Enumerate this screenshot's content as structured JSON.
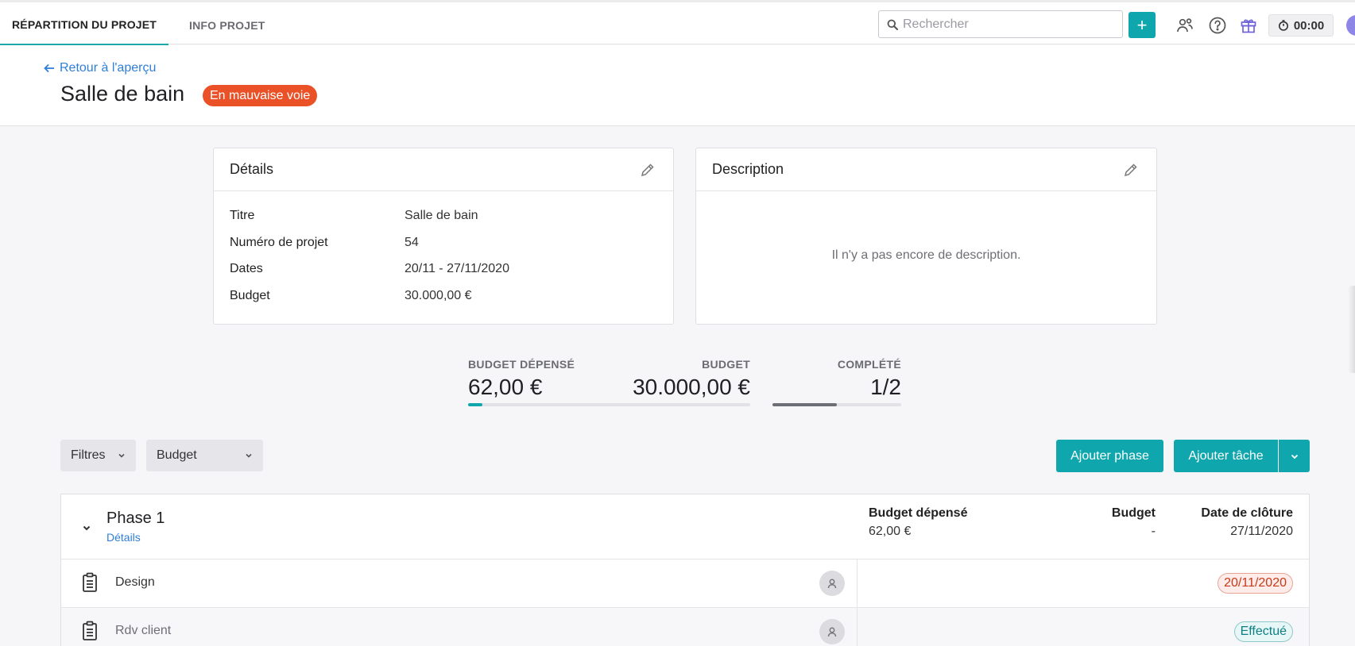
{
  "nav": {
    "tabs": [
      {
        "label": "RÉPARTITION DU PROJET",
        "active": true
      },
      {
        "label": "INFO PROJET",
        "active": false
      }
    ],
    "search_placeholder": "Rechercher",
    "add_label": "+",
    "timer": "00:00",
    "icons": [
      "search-icon",
      "team-icon",
      "help-icon",
      "gift-icon",
      "timer-icon",
      "avatar"
    ]
  },
  "header": {
    "back_link": "Retour à l'aperçu",
    "title": "Salle de bain",
    "status": "En mauvaise voie",
    "status_color": "#ea5126"
  },
  "details": {
    "heading": "Détails",
    "rows": [
      {
        "label": "Titre",
        "value": "Salle de bain"
      },
      {
        "label": "Numéro de projet",
        "value": "54"
      },
      {
        "label": "Dates",
        "value": "20/11 - 27/11/2020"
      },
      {
        "label": "Budget",
        "value": "30.000,00 €"
      }
    ]
  },
  "description": {
    "heading": "Description",
    "empty_text": "Il n'y a pas encore de description."
  },
  "stats": {
    "spent_label": "BUDGET DÉPENSÉ",
    "spent_value": "62,00 €",
    "budget_label": "BUDGET",
    "budget_value": "30.000,00 €",
    "budget_progress": 0.0021,
    "completed_label": "COMPLÉTÉ",
    "completed_value": "1/2",
    "completed_progress": 0.5,
    "accent": "#0fa7ad"
  },
  "toolbar": {
    "filters_label": "Filtres",
    "view_label": "Budget",
    "add_phase_label": "Ajouter phase",
    "add_task_label": "Ajouter tâche"
  },
  "phase": {
    "name": "Phase 1",
    "details_link": "Détails",
    "spent_header": "Budget dépensé",
    "spent_value": "62,00 €",
    "budget_header": "Budget",
    "budget_value": "-",
    "close_header": "Date de clôture",
    "close_value": "27/11/2020"
  },
  "tasks": [
    {
      "name": "Design",
      "tag": "20/11/2020",
      "tag_color": "#c63a17",
      "tag_bg": "#fdecea"
    },
    {
      "name": "Rdv client",
      "tag": "Effectué",
      "tag_color": "#0d7f83",
      "tag_bg": "#e7f7f7"
    }
  ]
}
